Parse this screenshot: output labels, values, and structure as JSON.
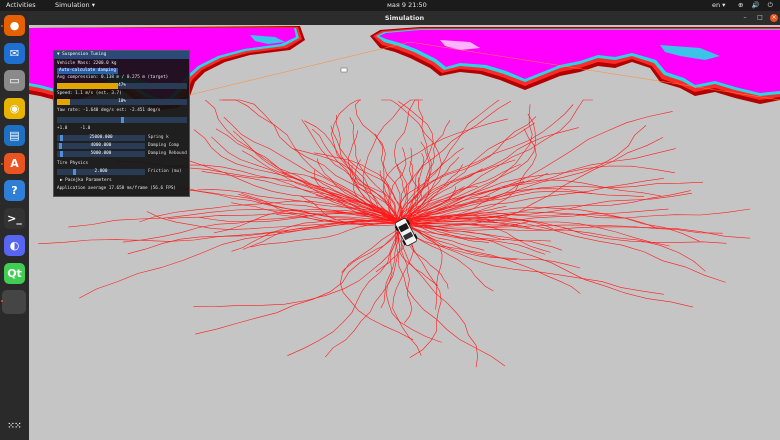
{
  "topbar": {
    "activities": "Activities",
    "app_menu": "Simulation ▾",
    "clock": "мая 9  21:50",
    "lang": "en ▾",
    "tray": "⊕ 🔊 ⏻ ▾"
  },
  "window": {
    "title": "Simulation"
  },
  "dock": {
    "items": [
      {
        "name": "firefox-icon",
        "glyph": "●",
        "color": "#e66000"
      },
      {
        "name": "thunderbird-icon",
        "glyph": "✉",
        "color": "#1f6fd0"
      },
      {
        "name": "files-icon",
        "glyph": "▭",
        "color": "#8a8a8a"
      },
      {
        "name": "rhythmbox-icon",
        "glyph": "◉",
        "color": "#e8b400"
      },
      {
        "name": "writer-icon",
        "glyph": "▤",
        "color": "#1d70c2"
      },
      {
        "name": "software-icon",
        "glyph": "A",
        "color": "#e95420"
      },
      {
        "name": "help-icon",
        "glyph": "?",
        "color": "#2f7fd8"
      },
      {
        "name": "terminal-icon",
        "glyph": ">_",
        "color": "#333333"
      },
      {
        "name": "discord-icon",
        "glyph": "◐",
        "color": "#5865f2"
      },
      {
        "name": "qtcreator-icon",
        "glyph": "Qt",
        "color": "#41cd52"
      },
      {
        "name": "simulation-icon",
        "glyph": "",
        "color": "#454545"
      }
    ],
    "grid_glyph": "⁙⁙"
  },
  "panel": {
    "title": "▼ Suspension Tuning",
    "vehicle_mass": "Vehicle Mass: 2200.0 kg",
    "auto_button": "Auto-calculate damping",
    "avg_compression": "Avg compression: 0.138 m / 0.275 m (target)",
    "progress1": {
      "label": "47%",
      "value": 0.47
    },
    "speed": "Speed: 1.1 m/s (est. 3.7)",
    "progress2": {
      "label": "10%",
      "value": 0.1
    },
    "yaw_rate": "Yaw rate: -1.640 deg/s est: -2.451 deg/s",
    "yaw_slider": {
      "value": 0.5
    },
    "yaw_left": "+1.0",
    "yaw_right": "-1.0",
    "spring_k": {
      "value_text": "25000.000",
      "label": "Spring k",
      "value": 0.05
    },
    "damping_comp": {
      "value_text": "4000.000",
      "label": "Damping Comp",
      "value": 0.04
    },
    "damping_rebound": {
      "value_text": "5000.000",
      "label": "Damping Rebound",
      "value": 0.05
    },
    "tire_physics": "Tire Physics",
    "friction": {
      "value_text": "2.000",
      "label": "Friction (mu)",
      "value": 0.2
    },
    "pacejka": "▶ Pacejka Parameters",
    "fps": "Application average 17.658 ms/frame (56.6 FPS)"
  },
  "colors": {
    "ground": "#c5c5c5",
    "paths": "#ff1a1a",
    "magenta": "#ff00ff",
    "cyan": "#26d8e6",
    "trim_red": "#ff2a2a",
    "deep_red": "#b00000",
    "accent": "#e95420"
  }
}
